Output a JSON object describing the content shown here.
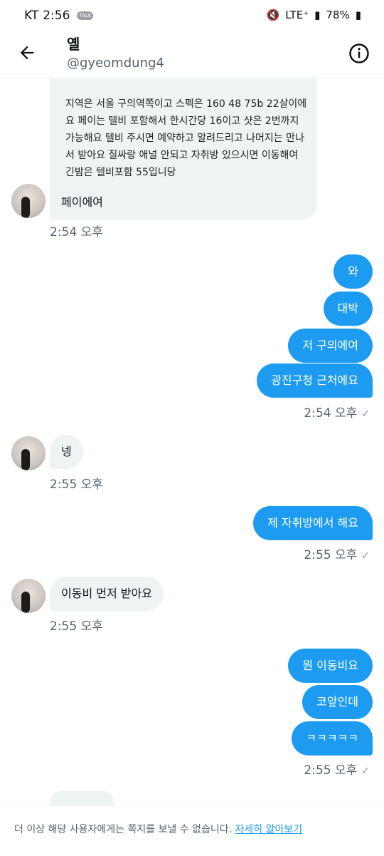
{
  "status": {
    "carrier": "KT",
    "time": "2:56",
    "talk": "TALK",
    "network": "LTE⁺",
    "battery": "78%"
  },
  "header": {
    "title": "옐",
    "handle": "@gyeomdung4"
  },
  "conversation": {
    "intro_text": "지역은 서울 구의역쪽이고 스펙은 160 48 75b 22살이에요 페이는 텔비 포함해서 한시간당 16이고 샷은 2번까지 가능해요 텔비 주시면 예약하고 알려드리고 나머지는 만나서 받아요 질싸랑 애널 안되고 자취방 있으시면 이동해여 긴밤은 텔비포함 55입니당",
    "reply_text": "페이에여",
    "time1": "2:54 오후",
    "out1": [
      "와",
      "대박",
      "저 구의에여",
      "광진구청 근처에요"
    ],
    "time2": "2:54 오후",
    "in2": "넹",
    "time3": "2:55 오후",
    "out2": "제 자취방에서 해요",
    "time4": "2:55 오후",
    "in3": "이동비 먼저 받아요",
    "time5": "2:55 오후",
    "out3": [
      "뭔 이동비요",
      "코앞인데",
      "ㅋㅋㅋㅋㅋ"
    ],
    "time6": "2:55 오후"
  },
  "footer": {
    "text": "더 이상 해당 사용자에게는 쪽지를 보낼 수 없습니다.",
    "link": "자세히 알아보기"
  },
  "colors": {
    "accent": "#1d9bf0",
    "bubble_in": "#eff3f4"
  },
  "icons": {
    "back": "arrow-left-icon",
    "info": "info-icon",
    "check": "check-icon"
  }
}
